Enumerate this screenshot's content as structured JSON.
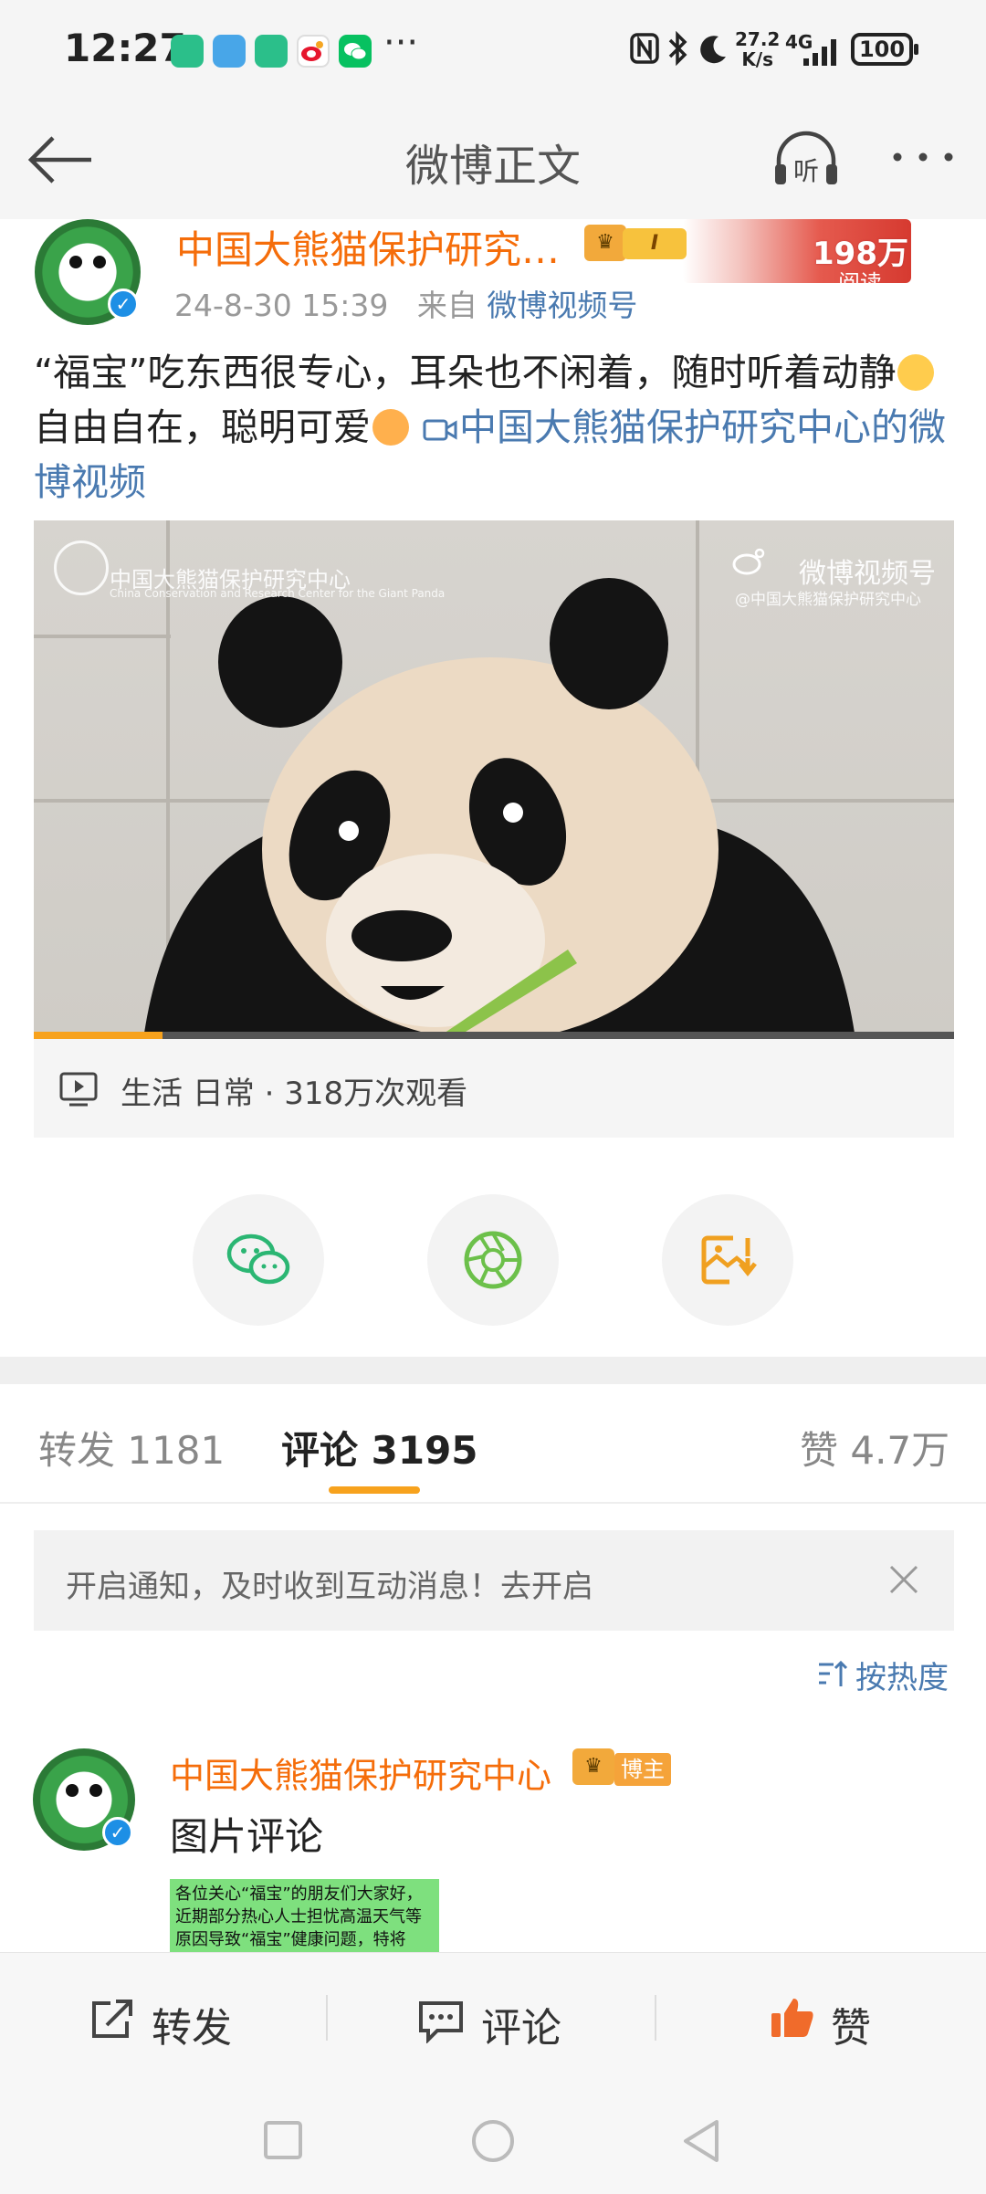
{
  "status_bar": {
    "time": "12:27",
    "more": "···",
    "net_speed_value": "27.2",
    "net_speed_unit": "K/s",
    "network": "4G",
    "battery": "100"
  },
  "header": {
    "title": "微博正文"
  },
  "post": {
    "author": "中国大熊猫保护研究…",
    "level": "I",
    "reads_num": "198万",
    "reads_label": "阅读",
    "time": "24-8-30 15:39",
    "source_prefix": "来自",
    "source": "微博视频号",
    "text_part1": "“福宝”吃东西很专心，耳朵也不闲着，随时听着动静",
    "text_part2": "自由自在，聪明可爱",
    "video_link": "中国大熊猫保护研究中心的微博视频",
    "video": {
      "watermark_left": "中国大熊猫保护研究中心",
      "watermark_left_sub": "China Conservation and Research Center for the Giant Panda",
      "watermark_right": "微博视频号",
      "watermark_right_sub": "@中国大熊猫保护研究中心",
      "progress": 0.14
    },
    "video_info": "生活 日常 · 318万次观看"
  },
  "tabs": {
    "repost": "转发 1181",
    "comment": "评论 3195",
    "like": "赞 4.7万"
  },
  "notice": {
    "text": "开启通知，及时收到互动消息！去开启"
  },
  "sort_label": "按热度",
  "comment": {
    "author": "中国大熊猫保护研究中心",
    "tag": "博主",
    "text": "图片评论",
    "image_text": "各位关心“福宝”的朋友们大家好，近期部分热心人士担忧高温天气等原因导致“福宝”健康问题，特将"
  },
  "bottom_bar": {
    "repost": "转发",
    "comment": "评论",
    "like": "赞"
  },
  "colors": {
    "accent": "#f7a21d",
    "name_orange": "#f56d0a",
    "link_blue": "#4a7ab0"
  }
}
